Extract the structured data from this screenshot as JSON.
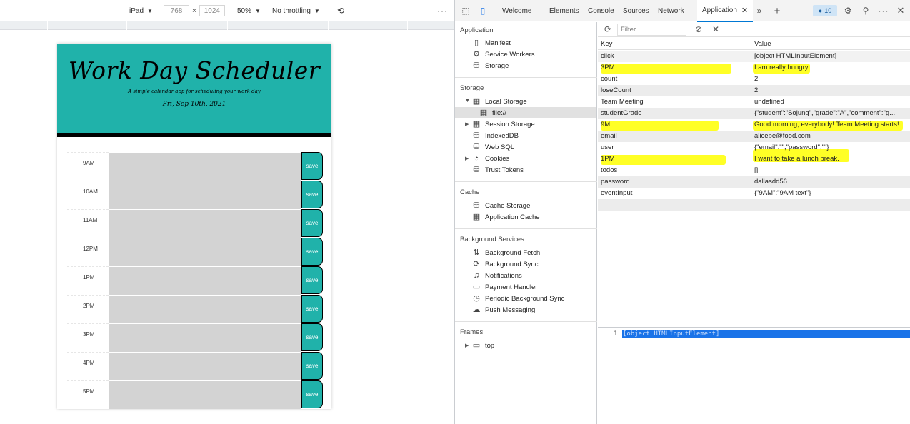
{
  "emulation": {
    "device": "iPad",
    "width": "768",
    "x_sep": "×",
    "height": "1024",
    "zoom": "50%",
    "throttling": "No throttling",
    "more": "⋮"
  },
  "app": {
    "title": "Work Day Scheduler",
    "subtitle": "A simple calendar app for scheduling your work day",
    "date": "Fri, Sep 10th, 2021",
    "save_label": "save",
    "hours": [
      "9AM",
      "10AM",
      "11AM",
      "12PM",
      "1PM",
      "2PM",
      "3PM",
      "4PM",
      "5PM"
    ]
  },
  "devtools": {
    "tabs": [
      "Welcome",
      "Elements",
      "Console",
      "Sources",
      "Network",
      "Application"
    ],
    "active_tab": "Application",
    "issues_count": "10",
    "sidebar": {
      "application_header": "Application",
      "application_items": [
        "Manifest",
        "Service Workers",
        "Storage"
      ],
      "storage_header": "Storage",
      "storage_items": [
        "Local Storage",
        "file://",
        "Session Storage",
        "IndexedDB",
        "Web SQL",
        "Cookies",
        "Trust Tokens"
      ],
      "cache_header": "Cache",
      "cache_items": [
        "Cache Storage",
        "Application Cache"
      ],
      "background_header": "Background Services",
      "background_items": [
        "Background Fetch",
        "Background Sync",
        "Notifications",
        "Payment Handler",
        "Periodic Background Sync",
        "Push Messaging"
      ],
      "frames_header": "Frames",
      "frames_items": [
        "top"
      ]
    },
    "filter_placeholder": "Filter",
    "table": {
      "key_header": "Key",
      "value_header": "Value",
      "rows": [
        {
          "key": "click",
          "value": "[object HTMLInputElement]"
        },
        {
          "key": "3PM",
          "value": "I am really hungry."
        },
        {
          "key": "count",
          "value": "2"
        },
        {
          "key": "loseCount",
          "value": "2"
        },
        {
          "key": "Team Meeting",
          "value": "undefined"
        },
        {
          "key": "studentGrade",
          "value": "{\"student\":\"Sojung\",\"grade\":\"A\",\"comment\":\"g..."
        },
        {
          "key": "9M",
          "value": "Good morning, everybody! Team Meeting starts!"
        },
        {
          "key": "email",
          "value": "alicebe@food.com"
        },
        {
          "key": "user",
          "value": "{\"email\":\"\",\"password\":\"\"}"
        },
        {
          "key": "1PM",
          "value": "I want to take a lunch break."
        },
        {
          "key": "todos",
          "value": "[]"
        },
        {
          "key": "password",
          "value": "dallasdd56"
        },
        {
          "key": "eventInput",
          "value": "{\"9AM\":\"9AM text\"}"
        }
      ]
    },
    "preview": {
      "line_number": "1",
      "text": "[object HTMLInputElement]"
    },
    "colors": {
      "highlight": "#ffff00",
      "selection": "#1a73e8",
      "scheduler_teal": "#20b2aa"
    }
  }
}
